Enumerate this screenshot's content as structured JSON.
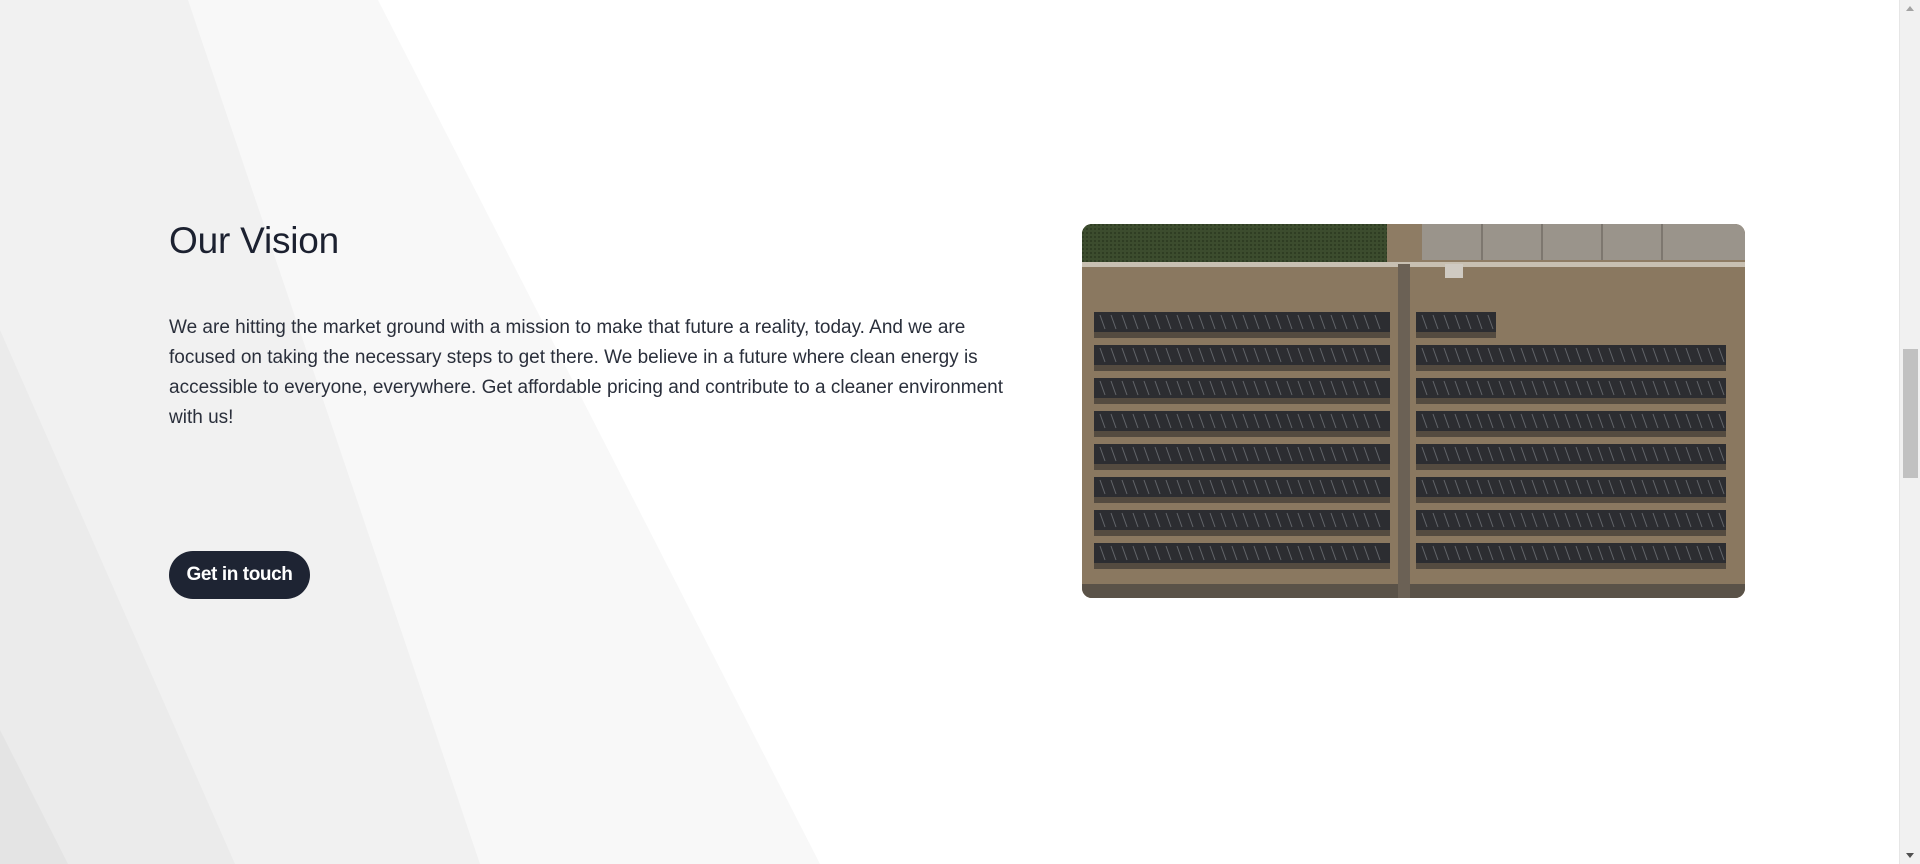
{
  "vision": {
    "title": "Our Vision",
    "body": "We are hitting the market ground with a mission to make that future a reality, today. And we are focused on taking the necessary steps to get there. We believe in a future where clean energy is accessible to everyone, everywhere. Get affordable pricing and contribute to a cleaner environment with us!",
    "cta_label": "Get in touch",
    "image_description": "aerial-solar-farm"
  },
  "colors": {
    "button_bg": "#1e2433",
    "heading_text": "#1c2130",
    "body_text": "#2a2f3b",
    "background": "#ffffff",
    "background_shape": "#f0f0f0"
  },
  "icons": {
    "scroll_up": "triangle-up",
    "scroll_down": "triangle-down"
  }
}
